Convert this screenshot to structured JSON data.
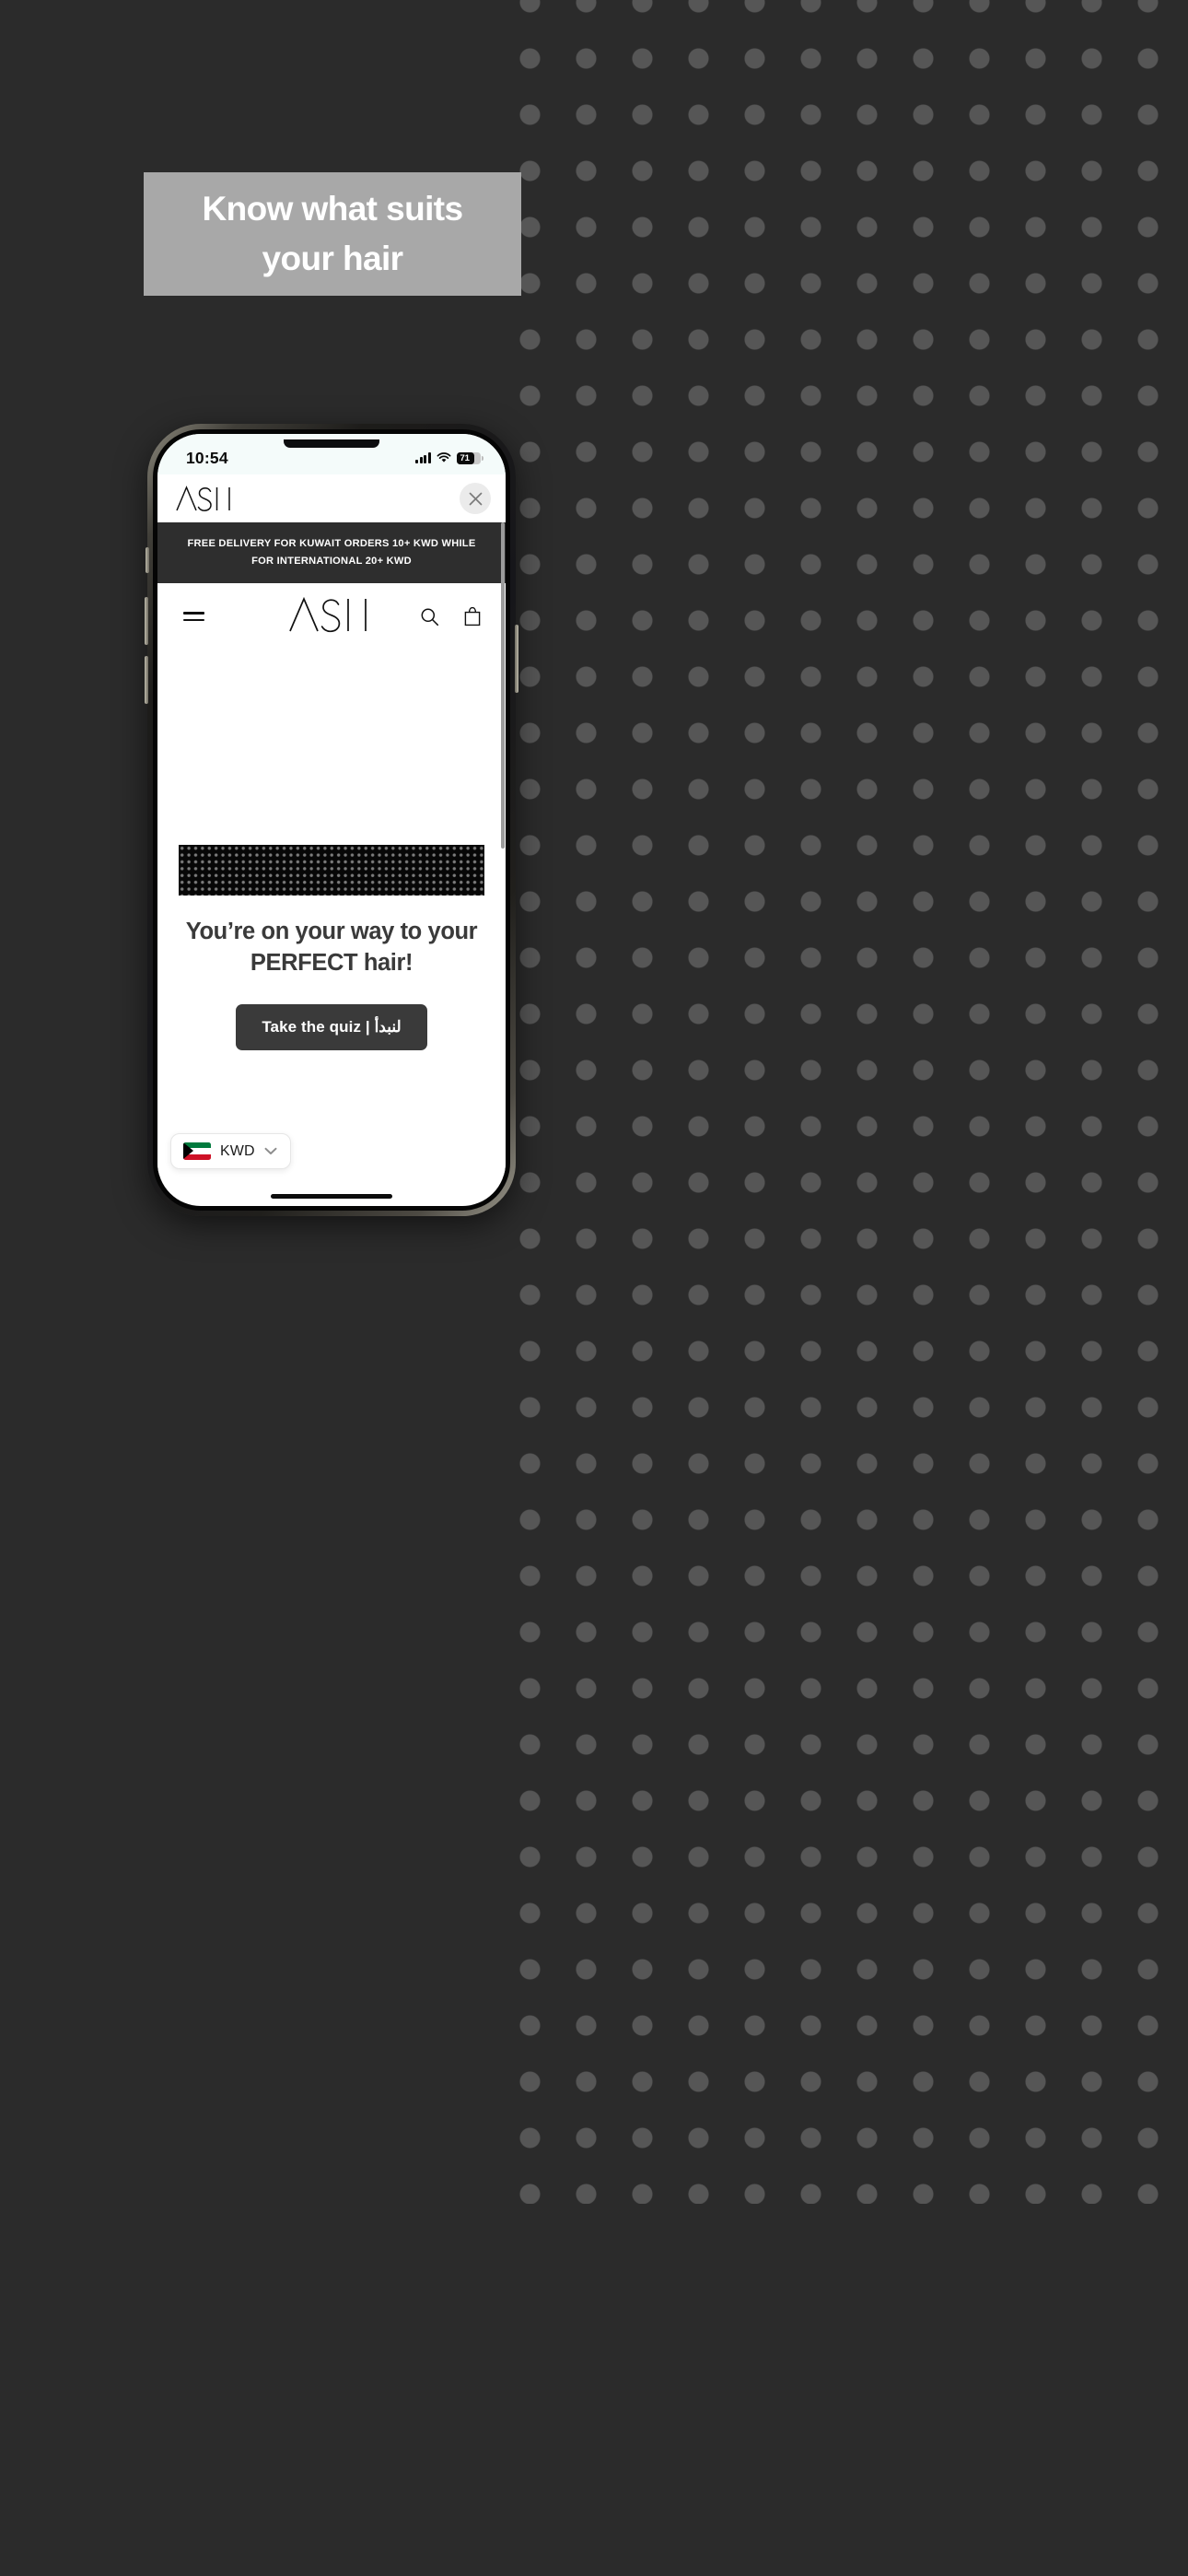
{
  "promo": {
    "headline": "Know what suits\nyour hair",
    "banner_bg": "#a8a8a8",
    "page_bg": "#2b2b2b",
    "dot_color": "#565656"
  },
  "status_bar": {
    "time": "10:54",
    "signal_icon": "cellular-signal-icon",
    "wifi_icon": "wifi-icon",
    "battery_percent": "71",
    "battery_icon": "battery-icon"
  },
  "browser": {
    "brand": "ASIL",
    "close_icon": "close-icon",
    "close_label": "Close"
  },
  "site": {
    "announcement": "FREE DELIVERY FOR KUWAIT ORDERS 10+ KWD WHILE\nFOR INTERNATIONAL 20+ KWD",
    "nav": {
      "menu_icon": "hamburger-menu-icon",
      "brand": "ASIL",
      "search_icon": "search-icon",
      "cart_icon": "shopping-bag-icon"
    },
    "hero": {
      "title": "You’re on your way to your\nPERFECT hair!",
      "cta_label": "Take the quiz | لنبدأ",
      "cta_bg": "#3a3a3a"
    }
  },
  "currency": {
    "code": "KWD",
    "flag_icon": "kuwait-flag-icon",
    "chevron_icon": "chevron-down-icon"
  }
}
